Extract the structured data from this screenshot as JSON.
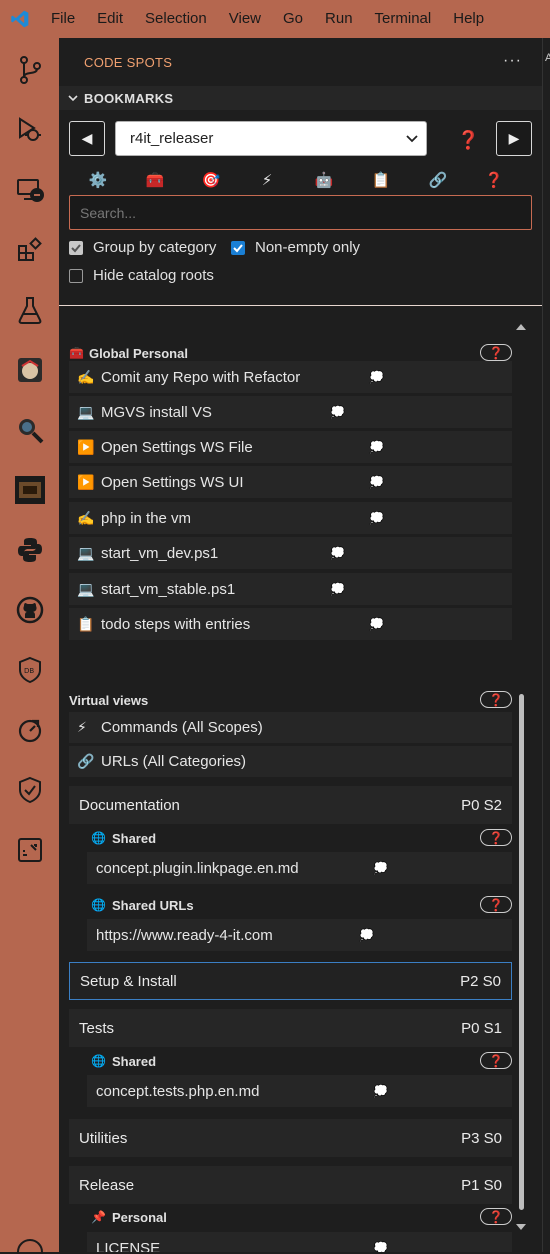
{
  "menubar": {
    "items": [
      "File",
      "Edit",
      "Selection",
      "View",
      "Go",
      "Run",
      "Terminal",
      "Help"
    ]
  },
  "activity_bar": {
    "items": [
      "source-control-icon",
      "run-debug-icon",
      "remote-explorer-icon",
      "extensions-icon",
      "testing-icon",
      "custom-extension-icon",
      "search-magnifier-icon",
      "game-extension-icon",
      "python-icon",
      "github-icon",
      "database-icon",
      "timeline-icon",
      "security-shield-icon",
      "dashboard-icon"
    ]
  },
  "view": {
    "title": "CODE SPOTS",
    "section": "BOOKMARKS"
  },
  "toolbar": {
    "prev_label": "◀",
    "next_label": "▶",
    "selected_repo": "r4it_releaser",
    "help_label": "❓"
  },
  "filter_icons": [
    "⚙️",
    "🧰",
    "🎯",
    "⚡",
    "🤖",
    "📋",
    "🔗",
    "❓"
  ],
  "search": {
    "placeholder": "Search..."
  },
  "options": {
    "group_by_category": "Group by category",
    "non_empty_only": "Non-empty only",
    "hide_catalog_roots": "Hide catalog roots"
  },
  "tree": {
    "global_personal": {
      "label": "Global Personal",
      "icon": "🧰",
      "items": [
        {
          "icon": "✍️",
          "label": "Comit any Repo with Refactor"
        },
        {
          "icon": "💻",
          "label": "MGVS install VS"
        },
        {
          "icon": "▶️",
          "label": "Open Settings WS File"
        },
        {
          "icon": "▶️",
          "label": "Open Settings WS UI"
        },
        {
          "icon": "✍️",
          "label": "php in the vm"
        },
        {
          "icon": "💻",
          "label": "start_vm_dev.ps1"
        },
        {
          "icon": "💻",
          "label": "start_vm_stable.ps1"
        },
        {
          "icon": "📋",
          "label": "todo steps with entries"
        }
      ]
    },
    "virtual_views": {
      "label": "Virtual views",
      "items": [
        {
          "icon": "⚡",
          "label": "Commands (All Scopes)"
        },
        {
          "icon": "🔗",
          "label": "URLs (All Categories)"
        }
      ]
    },
    "categories": {
      "documentation": {
        "label": "Documentation",
        "priority": "P0 S2"
      },
      "setup": {
        "label": "Setup & Install",
        "priority": "P2 S0"
      },
      "tests": {
        "label": "Tests",
        "priority": "P0 S1"
      },
      "utilities": {
        "label": "Utilities",
        "priority": "P3 S0"
      },
      "release": {
        "label": "Release",
        "priority": "P1 S0"
      }
    },
    "sub": {
      "shared": "Shared",
      "shared_urls": "Shared URLs",
      "personal": "Personal"
    },
    "entries": {
      "doc_shared": "concept.plugin.linkpage.en.md",
      "doc_url": "https://www.ready-4-it.com",
      "tests_shared": "concept.tests.php.en.md",
      "release_personal": "LICENSE"
    },
    "help_pill": "❓",
    "bubble": "💭",
    "globe": "🌐",
    "pin": "📌"
  }
}
